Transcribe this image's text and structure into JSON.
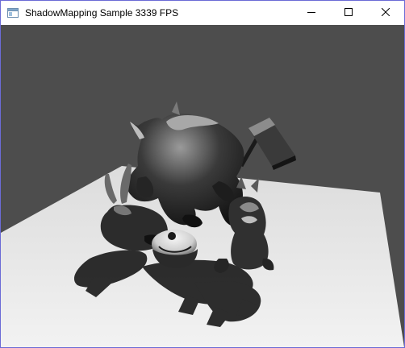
{
  "window": {
    "title": "ShadowMapping Sample 3339 FPS",
    "icon": "app-window-icon",
    "controls": {
      "minimize_icon": "minimize-icon",
      "maximize_icon": "maximize-icon",
      "close_icon": "close-icon"
    }
  },
  "scene": {
    "background_color": "#4d4d4d",
    "floor_color": "#ececec",
    "model_color": "#2a2a2a",
    "shadow_color": "#1c1c1c"
  }
}
